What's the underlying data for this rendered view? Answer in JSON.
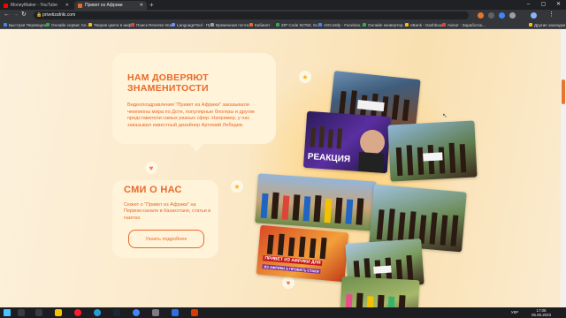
{
  "browser": {
    "tabs": [
      {
        "title": "MoneyMaker - YouTube",
        "color": "#ff0000"
      },
      {
        "title": "Привет из Африки",
        "color": "#e86a2c"
      }
    ],
    "url": "privetizafriki.com",
    "bookmarks": [
      {
        "label": "Быстрая Переводчик",
        "color": "#4285f4"
      },
      {
        "label": "Онлайн сервис Се...",
        "color": "#34a853"
      },
      {
        "label": "Твория цвета в инф...",
        "color": "#fbbc05"
      },
      {
        "label": "Поиск Reverse Ima...",
        "color": "#ea4335"
      },
      {
        "label": "LanguageTool - Пр...",
        "color": "#6e8efb"
      },
      {
        "label": "Временная почта...",
        "color": "#9aa0a6"
      },
      {
        "label": "Кабинет",
        "color": "#e86a2c"
      },
      {
        "label": "ZIP Code 92780, Sc...",
        "color": "#34a853"
      },
      {
        "label": "ADCostly - Faceboo...",
        "color": "#4285f4"
      },
      {
        "label": "Онлайн конвертер...",
        "color": "#34a853"
      },
      {
        "label": "eBank - Dashboard",
        "color": "#fbbc05"
      },
      {
        "label": "Avisor - Заработок...",
        "color": "#ea4335"
      },
      {
        "label": "Другие закладки",
        "color": "#fbbc05"
      }
    ]
  },
  "page": {
    "celebs": {
      "heading": "НАМ ДОВЕРЯЮТ ЗНАМЕНИТОСТИ",
      "body": "Видеопоздравления \"Привет из Африки\" заказывали чемпионы мира по Доте, популярные блогеры и другие представители самых разных сфер. Например, у нас заказывал известный дизайнер Артемий Лебедев."
    },
    "press": {
      "heading": "СМИ О НАС",
      "body": "Сюжет о \"Привет из Африки\" на Первом канале в Казахстане, статьи в газетах",
      "button": "Узнать подробнее"
    },
    "photo_labels": {
      "reaction": "РЕАКЦИЯ",
      "promo": "ПРИВЕТ ИЗ АФРИКИ ДЛЯ",
      "promo2": "ИЗ АФРИКИ & ПРОБЕГЬ СТАКИ"
    },
    "colors": {
      "accent": "#e86a2c",
      "card": "#fff3d9",
      "background": "#fbe9c9"
    }
  },
  "taskbar": {
    "lang": "УКР",
    "time": "17:05",
    "date": "05.06.2023"
  }
}
